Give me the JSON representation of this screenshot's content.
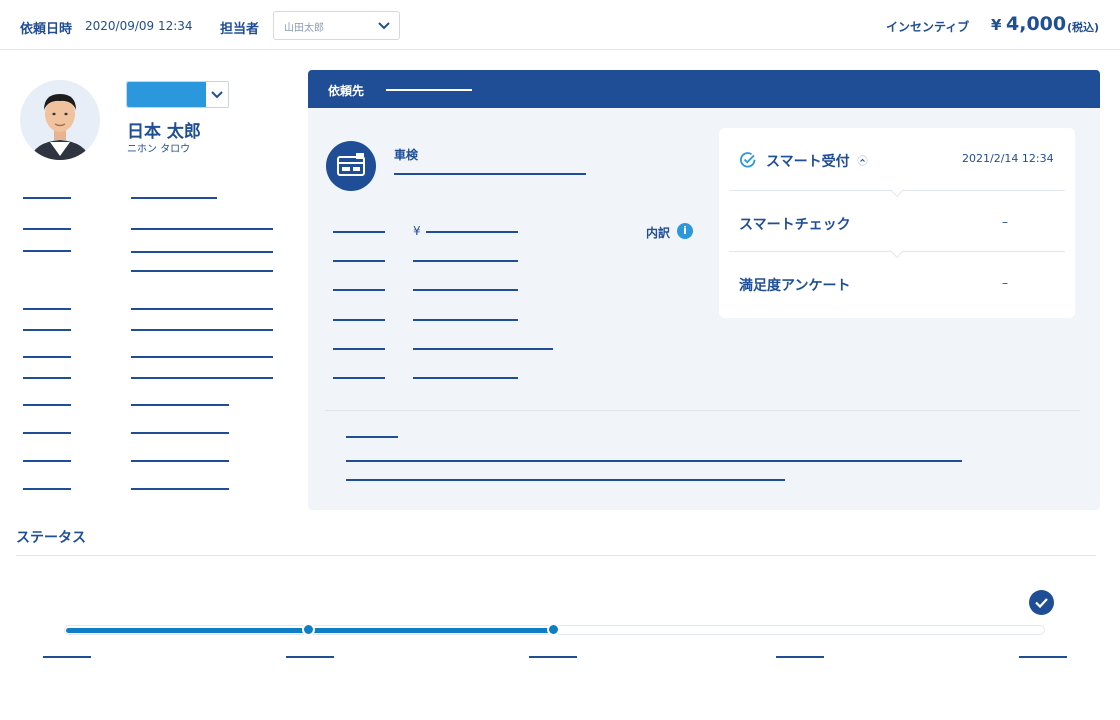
{
  "header": {
    "request_datetime_label": "依頼日時",
    "request_datetime_value": "2020/09/09 12:34",
    "assignee_label": "担当者",
    "assignee_value": "山田太郎",
    "incentive_label": "インセンティブ",
    "incentive_currency": "¥",
    "incentive_amount": "4,000",
    "incentive_tax": "(税込)"
  },
  "customer": {
    "name": "日本 太郎",
    "kana": "ニホン タロウ"
  },
  "panel": {
    "title": "依頼先",
    "service_label": "車検",
    "currency_symbol": "¥",
    "breakdown_label": "内訳",
    "info_glyph": "i"
  },
  "card": {
    "smart_reception_label": "スマート受付",
    "smart_reception_date": "2021/2/14 12:34",
    "smart_check_label": "スマートチェック",
    "smart_check_value": "–",
    "survey_label": "満足度アンケート",
    "survey_value": "–"
  },
  "status": {
    "title": "ステータス",
    "progress_fraction": 0.5
  },
  "colors": {
    "primary": "#1f4e96",
    "accent": "#2b97dd",
    "progress": "#0f7ec4",
    "panel_bg": "#f1f5fa"
  },
  "icons": {
    "assignee_dropdown": "chevron-down-icon",
    "avatar": "avatar",
    "service": "car-inspection-card-icon",
    "info": "info-icon",
    "check": "check-circle-icon",
    "collapse": "chevron-up-icon",
    "status_complete": "check-icon"
  }
}
